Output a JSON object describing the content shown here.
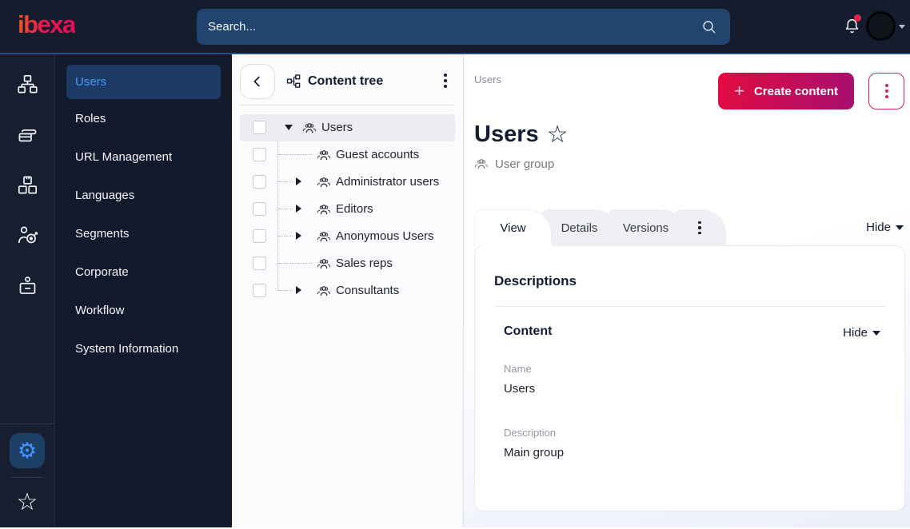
{
  "topbar": {
    "logo": "ibexa",
    "search_placeholder": "Search...",
    "icons": [
      "search-icon",
      "bell-icon",
      "avatar",
      "caret-down-icon"
    ]
  },
  "rail": {
    "icons": [
      "sitemap-icon",
      "pages-icon",
      "modules-icon",
      "personalization-icon",
      "admin-badge-icon",
      "gear-icon",
      "star-icon"
    ],
    "gear_glyph": "⚙",
    "star_glyph": "☆"
  },
  "sidebar": {
    "items": [
      {
        "label": "Users",
        "active": true
      },
      {
        "label": "Roles"
      },
      {
        "label": "URL Management"
      },
      {
        "label": "Languages"
      },
      {
        "label": "Segments"
      },
      {
        "label": "Corporate"
      },
      {
        "label": "Workflow"
      },
      {
        "label": "System Information"
      }
    ]
  },
  "tree": {
    "title": "Content tree",
    "items": [
      {
        "label": "Users",
        "depth": 0,
        "caret": "down",
        "selected": true
      },
      {
        "label": "Guest accounts",
        "depth": 1,
        "caret": "none"
      },
      {
        "label": "Administrator users",
        "depth": 1,
        "caret": "right"
      },
      {
        "label": "Editors",
        "depth": 1,
        "caret": "right"
      },
      {
        "label": "Anonymous Users",
        "depth": 1,
        "caret": "right"
      },
      {
        "label": "Sales reps",
        "depth": 1,
        "caret": "none"
      },
      {
        "label": "Consultants",
        "depth": 1,
        "caret": "right"
      }
    ]
  },
  "main": {
    "breadcrumb": "Users",
    "create_button": "Create content",
    "create_plus": "+",
    "title": "Users",
    "title_star": "☆",
    "subtitle": "User group",
    "tabs": [
      {
        "label": "View",
        "active": true
      },
      {
        "label": "Details"
      },
      {
        "label": "Versions"
      }
    ],
    "hide_label": "Hide",
    "card": {
      "heading": "Descriptions",
      "section_title": "Content",
      "section_hide_label": "Hide",
      "fields": [
        {
          "label": "Name",
          "value": "Users"
        },
        {
          "label": "Description",
          "value": "Main group"
        }
      ]
    }
  },
  "colors": {
    "topbar_bg": "#151c2d",
    "accent_blue_line": "#2b4d7c",
    "search_bg": "#21456e",
    "sidebar_bg": "#121a2c",
    "selected_item_bg": "#1c3a64",
    "selected_item_text": "#4b96fb",
    "gear_blue": "#4594ff",
    "create_gradient_start": "#e30b41",
    "create_gradient_end": "#a60f70",
    "kebab_pink": "#cd2367",
    "notification_dot": "#e0244b",
    "text_dark": "#131c33",
    "tree_row_highlight": "#ededf1"
  }
}
